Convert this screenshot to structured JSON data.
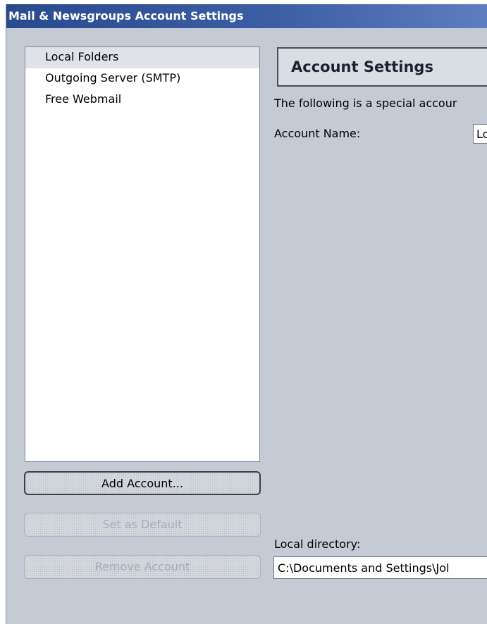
{
  "window": {
    "title": "Mail & Newsgroups Account Settings"
  },
  "account_list": {
    "items": [
      {
        "label": "Local Folders",
        "selected": true
      },
      {
        "label": "Outgoing Server (SMTP)",
        "selected": false
      },
      {
        "label": "Free Webmail",
        "selected": false
      }
    ]
  },
  "buttons": {
    "add_account": "Add Account...",
    "set_default": "Set as Default",
    "remove_account": "Remove Account"
  },
  "panel": {
    "header": "Account Settings",
    "description": "The following is a special accour",
    "account_name_label": "Account Name:",
    "account_name_value": "Lo",
    "local_directory_label": "Local directory:",
    "local_directory_value": "C:\\Documents and Settings\\Jol"
  },
  "colors": {
    "titlebar": "#2a4a8e",
    "dialog_background": "#c5cbd4",
    "selected_item": "#dfe2e8",
    "disabled_text": "#a4abb5"
  }
}
